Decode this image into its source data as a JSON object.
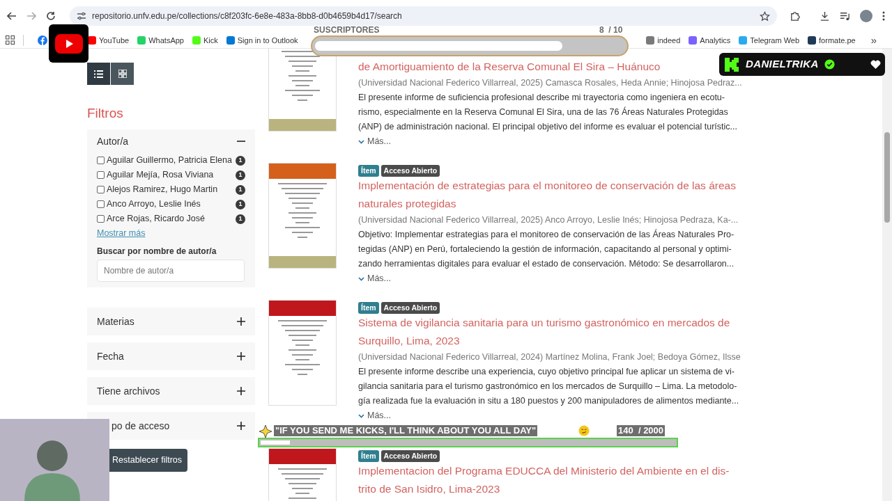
{
  "browser": {
    "url": "repositorio.unfv.edu.pe/collections/c8f203fc-6e8e-483a-8bb8-d0b4659b4d17/search",
    "bookmarks_start": [
      {
        "label": "YouTube",
        "color": "#ff0000"
      },
      {
        "label": "WhatsApp",
        "color": "#25d366"
      },
      {
        "label": "Kick",
        "color": "#53fc18"
      },
      {
        "label": "Sign in to Outlook",
        "color": "#0078d4"
      }
    ],
    "bookmarks_end": [
      {
        "label": "indeed",
        "color": "#7a7a7a"
      },
      {
        "label": "Analytics",
        "color": "#7b61ff"
      },
      {
        "label": "Telegram Web",
        "color": "#2aabee"
      },
      {
        "label": "formate.pe",
        "color": "#1f3b57"
      }
    ],
    "more_bookmarks": "»"
  },
  "view_modes": [
    {
      "kind": "list",
      "selected": true
    },
    {
      "kind": "grid",
      "selected": false
    }
  ],
  "filters": {
    "title": "Filtros",
    "sections": [
      {
        "label": "Autor/a",
        "expanded": true,
        "options": [
          {
            "label": "Aguilar Guillermo, Patricia Elena",
            "count": "1",
            "checked": false
          },
          {
            "label": "Aguilar Mejía, Rosa Viviana",
            "count": "1",
            "checked": false
          },
          {
            "label": "Alejos Ramirez, Hugo Martin",
            "count": "1",
            "checked": false
          },
          {
            "label": "Anco Arroyo, Leslie Inés",
            "count": "1",
            "checked": false
          },
          {
            "label": "Arce Rojas, Ricardo José",
            "count": "1",
            "checked": false
          }
        ],
        "show_more": "Mostrar más",
        "search_label": "Buscar por nombre de autor/a",
        "search_placeholder": "Nombre de autor/a"
      },
      {
        "label": "Materias",
        "expanded": false
      },
      {
        "label": "Fecha",
        "expanded": false
      },
      {
        "label": "Tiene archivos",
        "expanded": false
      },
      {
        "label": "po de acceso",
        "expanded": false
      }
    ],
    "reset": "Restablecer filtros"
  },
  "results": [
    {
      "title": "de Amortiguamiento de la Reserva Comunal El Sira – Huánuco",
      "meta": "(Universidad Nacional Federico Villarreal, 2025) Camasca Rosales, Heda Annie; Hinojosa Pedraz...",
      "description": "El presente informe de suficiencia profesional describe mi trayectoria como ingeniera en ecotu-\nrismo, especialmente en la Reserva Comunal El Sira, una de las 76 Áreas Naturales Protegidas\n(ANP) de administración nacional. El principal objetivo del informe es evaluar el potencial turístic...",
      "more": "Más...",
      "footer_band": true
    },
    {
      "badges": [
        {
          "label": "Ítem",
          "kind": "type"
        },
        {
          "label": "Acceso Abierto",
          "kind": "access"
        }
      ],
      "color": "#d4601c",
      "title": "Implementación de estrategias para el monitoreo de conservación de las áreas\nnaturales protegidas",
      "meta": "(Universidad Nacional Federico Villarreal, 2025) Anco Arroyo, Leslie Inés; Hinojosa Pedraza, Ka-...",
      "description": "Objetivo: Implementar estrategias para el monitoreo de conservación de las Áreas Naturales Pro-\ntegidas (ANP) en Perú, fortaleciendo la gestión de información, capacitando al personal y optimi-\nzando herramientas digitales para evaluar el estado de conservación. Método: Se desarrollaron...",
      "more": "Más...",
      "footer_band": true
    },
    {
      "badges": [
        {
          "label": "Ítem",
          "kind": "type"
        },
        {
          "label": "Acceso Abierto",
          "kind": "access"
        }
      ],
      "color": "#c0171c",
      "title": "Sistema de vigilancia sanitaria para un turismo gastronómico en mercados de\nSurquillo, Lima, 2023",
      "meta": "(Universidad Nacional Federico Villarreal, 2024) Martínez Molina, Frank Joel; Bedoya Gómez, Ilsse",
      "description": "El presente informe describe una experiencia, cuyo objetivo principal fue aplicar un sistema de vi-\ngilancia sanitaria para el turismo gastronómico en los mercados de Surquillo – Lima. La metodolo-\ngía realizada fue la evaluación in situ a 180 puestos y 200 manipuladores de alimentos mediante...",
      "more": "Más...",
      "footer_band": false
    },
    {
      "badges": [
        {
          "label": "Ítem",
          "kind": "type"
        },
        {
          "label": "Acceso Abierto",
          "kind": "access"
        }
      ],
      "color": "#c0171c",
      "title": "Implementacion del Programa EDUCCA del Ministerio del Ambiente en el dis-\ntrito de San Isidro, Lima-2023"
    }
  ],
  "stream_overlay": {
    "goal": {
      "title": "SUSCRIPTORES",
      "count": "8  / 10",
      "level": 0.8
    },
    "channel": {
      "name": "DANIELTRIKA",
      "verified": true
    },
    "chat_goal": {
      "text": "\"IF YOU SEND ME KICKS, I'LL THINK ABOUT YOU ALL DAY\"",
      "count": "140  / 2000",
      "level": 0.07
    }
  }
}
